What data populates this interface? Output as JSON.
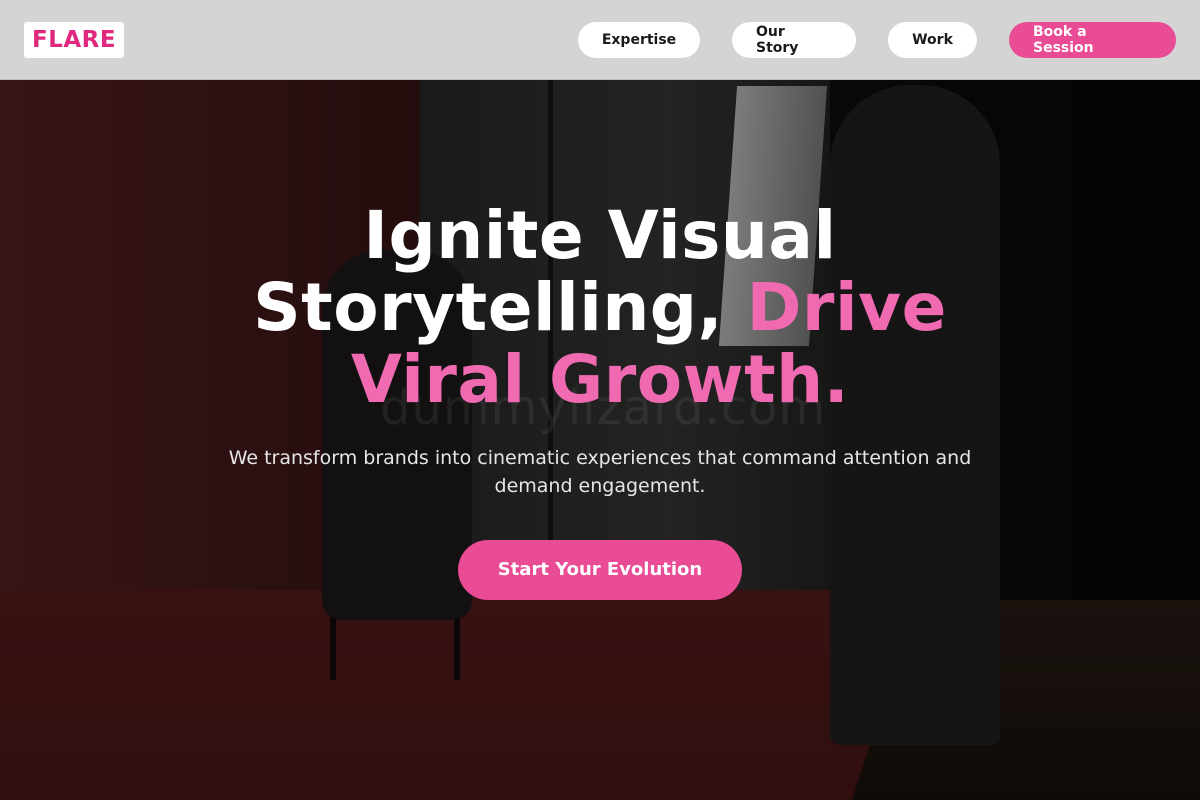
{
  "header": {
    "logo": "FLARE",
    "nav": [
      {
        "label": "Expertise"
      },
      {
        "label": "Our Story"
      },
      {
        "label": "Work"
      }
    ],
    "cta_label": "Book a Session"
  },
  "hero": {
    "headline_line1": "Ignite Visual",
    "headline_line2_white": "Storytelling, ",
    "headline_line2_accent": "Drive",
    "headline_line3_accent": "Viral Growth.",
    "subtitle": "We transform brands into cinematic experiences that command attention and demand engagement.",
    "cta_label": "Start Your Evolution",
    "watermark": "dummylizard.com"
  },
  "colors": {
    "accent": "#e94b95",
    "accent_text": "#f06ab1",
    "logo": "#e0287e",
    "header_bg": "#d4d4d4"
  }
}
